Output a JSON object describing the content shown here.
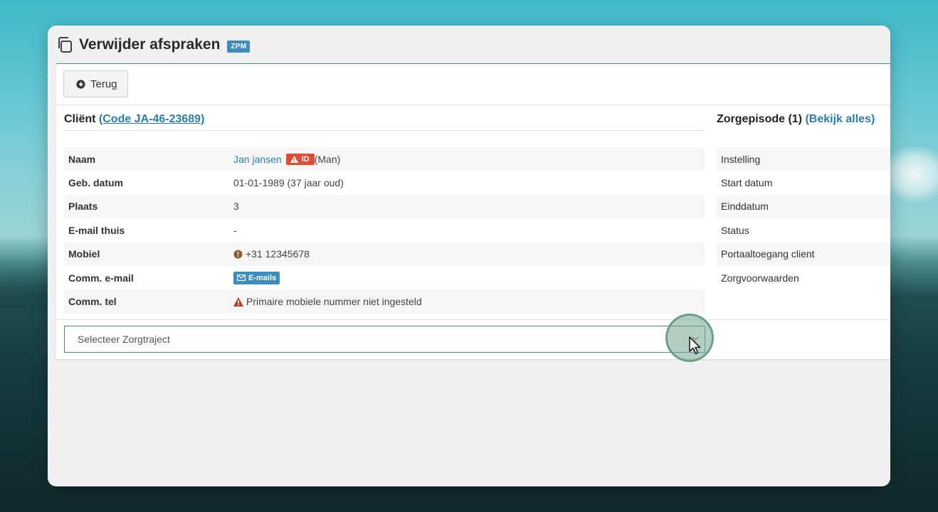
{
  "window": {
    "title": "Verwijder afspraken",
    "badge": "ZPM",
    "icon": "copy-icon"
  },
  "toolbar": {
    "back_label": "Terug",
    "back_icon": "arrow-circle-left-icon"
  },
  "client": {
    "heading": "Cliënt",
    "code_link": "(Code JA-46-23689)",
    "rows": [
      {
        "label": "Naam",
        "value": "Jan jansen"
      },
      {
        "label": "Geb. datum",
        "value": "01-01-1989 (37 jaar oud)"
      },
      {
        "label": "Plaats",
        "value": "3"
      },
      {
        "label": "E-mail thuis",
        "value": "-"
      },
      {
        "label": "Mobiel",
        "value": "+31 12345678"
      },
      {
        "label": "Comm. e-mail",
        "value": "E-mails"
      },
      {
        "label": "Comm. tel",
        "value": "Primaire mobiele nummer niet ingesteld"
      }
    ],
    "id_badge": "ID",
    "gender": "(Man)"
  },
  "zorgepisode": {
    "heading": "Zorgepisode (1)",
    "link": "(Bekijk alles)",
    "rows": [
      "Instelling",
      "Start datum",
      "Einddatum",
      "Status",
      "Portaaltoegang client",
      "Zorgvoorwaarden"
    ]
  },
  "select": {
    "placeholder": "Selecteer Zorgtraject"
  },
  "colors": {
    "accent": "#3b8dbd",
    "danger": "#dd4b39",
    "warning": "#a0522d",
    "link": "#2e7db0"
  }
}
